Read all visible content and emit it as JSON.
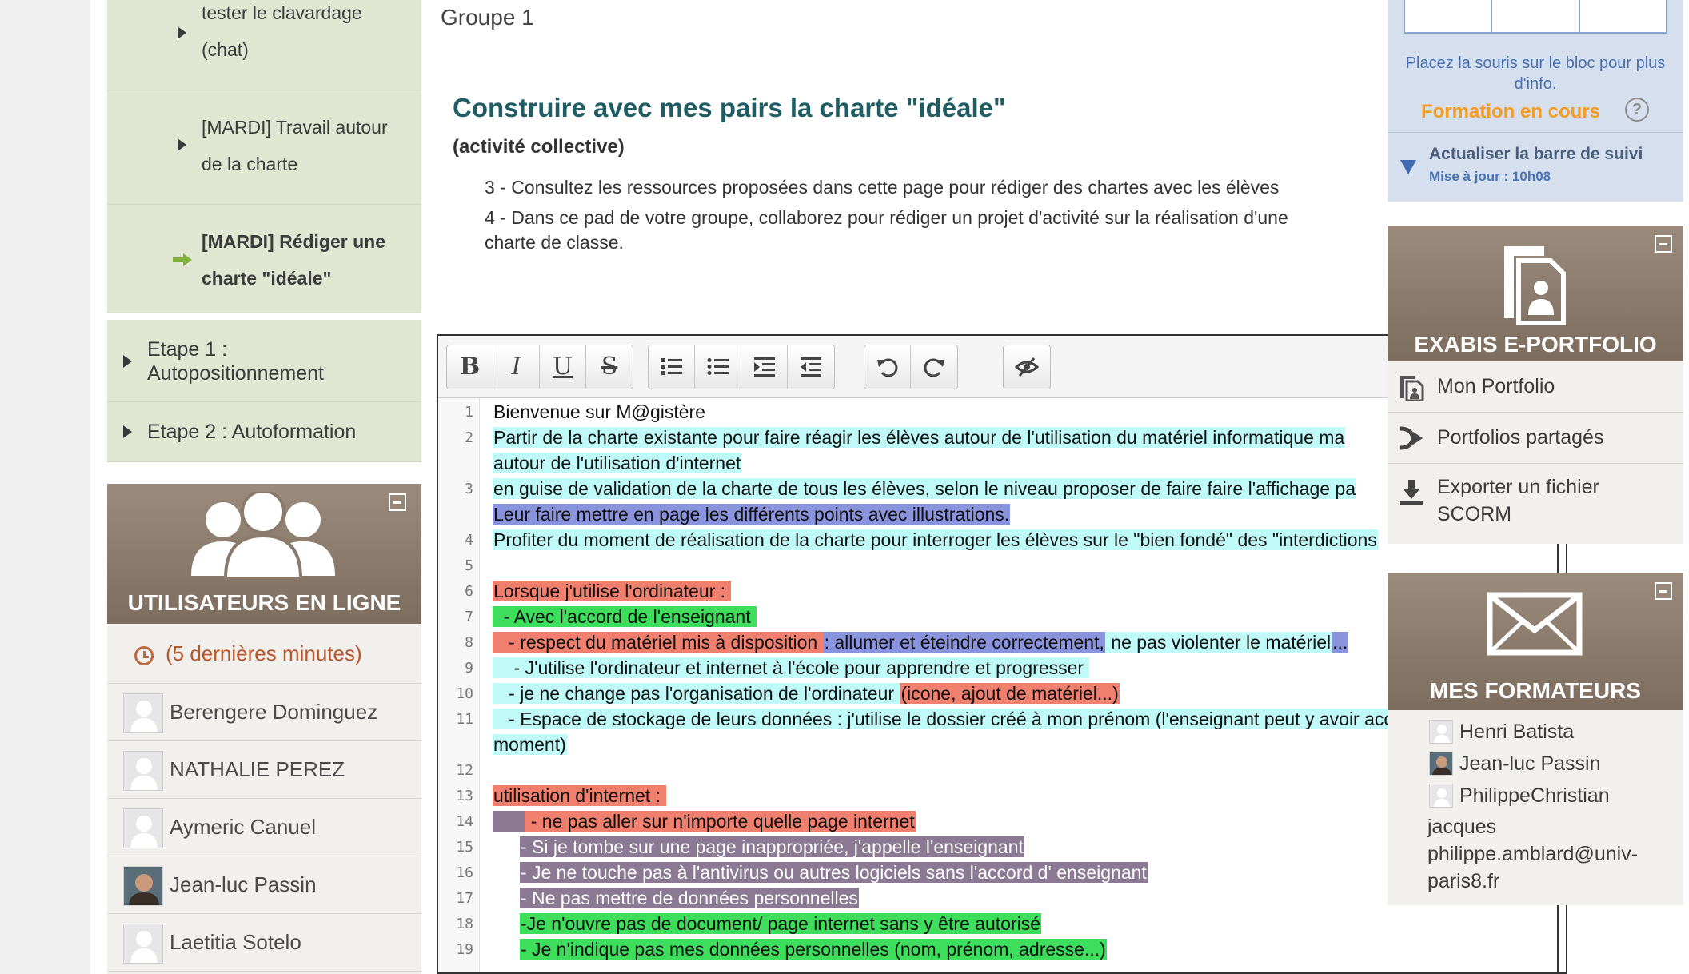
{
  "left_nav": {
    "items": [
      {
        "label_line1": "tester le clavardage",
        "label_line2": "(chat)",
        "active": false
      },
      {
        "label_line1": "[MARDI] Travail autour",
        "label_line2": "de la charte",
        "active": false
      },
      {
        "label_line1": "[MARDI] Rédiger une",
        "label_line2": "charte \"idéale\"",
        "active": true
      }
    ],
    "steps": [
      {
        "label_line1": "Etape 1 :",
        "label_line2": "Autopositionnement"
      },
      {
        "label_line1": "Etape 2 : Autoformation",
        "label_line2": ""
      }
    ]
  },
  "online_users": {
    "title": "UTILISATEURS EN LIGNE",
    "period": "(5 dernières minutes)",
    "users": [
      "Berengere Dominguez",
      "NATHALIE PEREZ",
      "Aymeric Canuel",
      "Jean-luc Passin",
      "Laetitia Sotelo"
    ]
  },
  "main": {
    "group_label": "Groupe 1",
    "title": "Construire avec mes pairs la charte \"idéale\"",
    "subtitle": "(activité collective)",
    "instruction_3": "3 -  Consultez les ressources proposées dans cette page pour rédiger des chartes avec les élèves",
    "instruction_4": "4 - Dans ce pad de votre groupe, collaborez pour rédiger un projet d'activité sur la réalisation d'une charte de classe."
  },
  "editor": {
    "toolbar": {
      "bold": "B",
      "italic": "I",
      "underline": "U",
      "strike": "S"
    },
    "lines": [
      {
        "n": "1",
        "segments": [
          {
            "t": "Bienvenue sur M@gistère",
            "c": ""
          }
        ]
      },
      {
        "n": "2",
        "segments": [
          {
            "t": "Partir de la charte existante pour faire réagir les élèves autour de l'utilisation du matériel informatique ma",
            "c": "c-cyan"
          }
        ]
      },
      {
        "n": "",
        "segments": [
          {
            "t": "autour de l'utilisation d'internet",
            "c": "c-cyan"
          }
        ]
      },
      {
        "n": "3",
        "segments": [
          {
            "t": "en guise de validation de la charte de tous les élèves, selon le niveau proposer de faire faire l'affichage pa",
            "c": "c-cyan"
          }
        ]
      },
      {
        "n": "",
        "segments": [
          {
            "t": "Leur faire mettre en page les différents points avec illustrations.",
            "c": "c-blue"
          }
        ]
      },
      {
        "n": "4",
        "segments": [
          {
            "t": "Profiter du moment de réalisation de la charte pour interroger les élèves sur le \"bien fondé\" des \"interdictions",
            "c": "c-cyan"
          }
        ]
      },
      {
        "n": "5",
        "segments": [
          {
            "t": "",
            "c": ""
          }
        ]
      },
      {
        "n": "6",
        "segments": [
          {
            "t": "Lorsque j'utilise l'ordinateur : ",
            "c": "c-red"
          }
        ]
      },
      {
        "n": "7",
        "segments": [
          {
            "t": "  - Avec l'accord de l'enseignant ",
            "c": "c-green"
          }
        ]
      },
      {
        "n": "8",
        "segments": [
          {
            "t": "   - respect du matériel mis à disposition ",
            "c": "c-red"
          },
          {
            "t": ": allumer et éteindre correctement,",
            "c": "c-blue"
          },
          {
            "t": " ne pas violenter le matériel",
            "c": "c-cyan"
          },
          {
            "t": "...",
            "c": "c-blue"
          }
        ]
      },
      {
        "n": "9",
        "segments": [
          {
            "t": "    - J'utilise l'ordinateur et internet à l'école pour apprendre et progresser ",
            "c": "c-cyan"
          }
        ]
      },
      {
        "n": "10",
        "segments": [
          {
            "t": "   - je ne change pas l'organisation de l'ordinateur ",
            "c": "c-cyan"
          },
          {
            "t": "(icone, ajout de matériel...)",
            "c": "c-red"
          }
        ]
      },
      {
        "n": "11",
        "segments": [
          {
            "t": "   - Espace de stockage de leurs données : j'utilise le dossier créé à mon prénom (l'enseignant peut y avoir accès à tout",
            "c": "c-cyan"
          }
        ]
      },
      {
        "n": "",
        "segments": [
          {
            "t": "moment)",
            "c": "c-cyan"
          }
        ]
      },
      {
        "n": "12",
        "segments": [
          {
            "t": "",
            "c": ""
          }
        ]
      },
      {
        "n": "13",
        "segments": [
          {
            "t": "utilisation d'internet : ",
            "c": "c-red"
          }
        ]
      },
      {
        "n": "14",
        "segments": [
          {
            "t": "      ",
            "c": "c-purple"
          },
          {
            "t": " - ne pas aller sur n'importe quelle page internet",
            "c": "c-red"
          }
        ]
      },
      {
        "n": "15",
        "segments": [
          {
            "t": "     ",
            "c": ""
          },
          {
            "t": "- Si je tombe sur une page inappropriée, j'appelle l'enseignant",
            "c": "c-purple"
          }
        ]
      },
      {
        "n": "16",
        "segments": [
          {
            "t": "     ",
            "c": ""
          },
          {
            "t": "- Je ne touche pas à l'antivirus ou autres logiciels sans l'accord d' enseignant",
            "c": "c-purple"
          }
        ]
      },
      {
        "n": "17",
        "segments": [
          {
            "t": "     ",
            "c": ""
          },
          {
            "t": "- Ne pas mettre de données personnelles",
            "c": "c-purple"
          }
        ]
      },
      {
        "n": "18",
        "segments": [
          {
            "t": "     ",
            "c": ""
          },
          {
            "t": "-Je n'ouvre pas de document/ page internet sans y être autorisé",
            "c": "c-green"
          }
        ]
      },
      {
        "n": "19",
        "segments": [
          {
            "t": "     ",
            "c": ""
          },
          {
            "t": "- Je n'indique pas mes données personnelles (nom, prénom, adresse...)",
            "c": "c-green"
          }
        ]
      }
    ]
  },
  "right": {
    "hover_info": "Placez la souris sur le bloc pour plus d'info.",
    "formation_label": "Formation en cours",
    "help_icon": "?",
    "update_title": "Actualiser la barre de suivi",
    "update_sub": "Mise à jour : 10h08",
    "portfolio": {
      "title": "EXABIS E-PORTFOLIO",
      "items": [
        {
          "label": "Mon Portfolio",
          "icon": "portfolio-icon"
        },
        {
          "label": "Portfolios partagés",
          "icon": "share-icon"
        },
        {
          "label": "Exporter un fichier SCORM",
          "icon": "download-icon"
        }
      ]
    },
    "trainers": {
      "title": "MES FORMATEURS",
      "names": [
        "Henri Batista",
        "Jean-luc Passin",
        "PhilippeChristian"
      ],
      "extra_line1": "jacques",
      "extra_line2": "philippe.amblard@univ-",
      "extra_line3": "paris8.fr"
    }
  }
}
